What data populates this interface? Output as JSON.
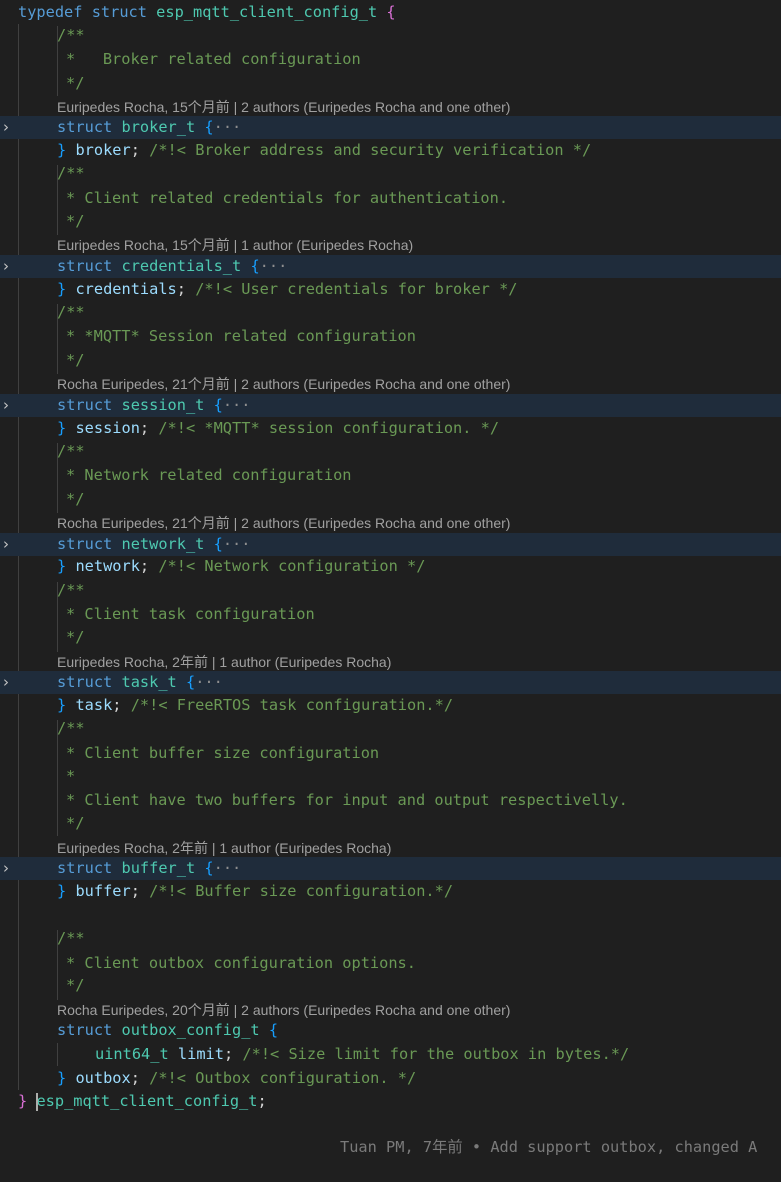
{
  "editor": {
    "lines": {
      "typedef_kw": "typedef",
      "struct_kw": "struct",
      "struct_name": "esp_mqtt_client_config_t",
      "open_brace": "{",
      "c1_open": "/**",
      "c1_body": "*   Broker related configuration",
      "c1_close": "*/",
      "s1_kw": "struct",
      "s1_name": "broker_t",
      "s1_brace": "{",
      "s1_ellipsis": "···",
      "s1_close": "}",
      "s1_member": "broker",
      "s1_semi": ";",
      "s1_comment": "/*!< Broker address and security verification */",
      "c2_open": "/**",
      "c2_body": "* Client related credentials for authentication.",
      "c2_close": "*/",
      "s2_kw": "struct",
      "s2_name": "credentials_t",
      "s2_brace": "{",
      "s2_ellipsis": "···",
      "s2_close": "}",
      "s2_member": "credentials",
      "s2_semi": ";",
      "s2_comment": "/*!< User credentials for broker */",
      "c3_open": "/**",
      "c3_body": "* *MQTT* Session related configuration",
      "c3_close": "*/",
      "s3_kw": "struct",
      "s3_name": "session_t",
      "s3_brace": "{",
      "s3_ellipsis": "···",
      "s3_close": "}",
      "s3_member": "session",
      "s3_semi": ";",
      "s3_comment": "/*!< *MQTT* session configuration. */",
      "c4_open": "/**",
      "c4_body": "* Network related configuration",
      "c4_close": "*/",
      "s4_kw": "struct",
      "s4_name": "network_t",
      "s4_brace": "{",
      "s4_ellipsis": "···",
      "s4_close": "}",
      "s4_member": "network",
      "s4_semi": ";",
      "s4_comment": "/*!< Network configuration */",
      "c5_open": "/**",
      "c5_body": "* Client task configuration",
      "c5_close": "*/",
      "s5_kw": "struct",
      "s5_name": "task_t",
      "s5_brace": "{",
      "s5_ellipsis": "···",
      "s5_close": "}",
      "s5_member": "task",
      "s5_semi": ";",
      "s5_comment": "/*!< FreeRTOS task configuration.*/",
      "c6_open": "/**",
      "c6_body1": "* Client buffer size configuration",
      "c6_body2": "*",
      "c6_body3": "* Client have two buffers for input and output respectivelly.",
      "c6_close": "*/",
      "s6_kw": "struct",
      "s6_name": "buffer_t",
      "s6_brace": "{",
      "s6_ellipsis": "···",
      "s6_close": "}",
      "s6_member": "buffer",
      "s6_semi": ";",
      "s6_comment": "/*!< Buffer size configuration.*/",
      "c7_open": "/**",
      "c7_body": "* Client outbox configuration options.",
      "c7_close": "*/",
      "s7_kw": "struct",
      "s7_name": "outbox_config_t",
      "s7_brace": "{",
      "f7_type": "uint64_t",
      "f7_name": "limit",
      "f7_semi": ";",
      "f7_comment": "/*!< Size limit for the outbox in bytes.*/",
      "s7_close": "}",
      "s7_member": "outbox",
      "s7_semi": ";",
      "s7_comment": "/*!< Outbox configuration. */",
      "end_brace": "}",
      "end_name": "esp_mqtt_client_config_t",
      "end_semi": ";"
    },
    "codelens": {
      "broker": "Euripedes Rocha, 15个月前 | 2 authors (Euripedes Rocha and one other)",
      "credentials": "Euripedes Rocha, 15个月前 | 1 author (Euripedes Rocha)",
      "session": "Rocha Euripedes, 21个月前 | 2 authors (Euripedes Rocha and one other)",
      "network": "Rocha Euripedes, 21个月前 | 2 authors (Euripedes Rocha and one other)",
      "task": "Euripedes Rocha, 2年前 | 1 author (Euripedes Rocha)",
      "buffer": "Euripedes Rocha, 2年前 | 1 author (Euripedes Rocha)",
      "outbox": "Rocha Euripedes, 20个月前 | 2 authors (Euripedes Rocha and one other)"
    },
    "inline_blame": "Tuan PM, 7年前 • Add support outbox, changed A"
  },
  "icons": {
    "fold": "chevron-right-icon"
  },
  "colors": {
    "background": "#1f1f1f",
    "keyword": "#569cd6",
    "type": "#4ec9b0",
    "identifier": "#9cdcfe",
    "comment": "#6a9955",
    "folded_line": "#1f2c3b",
    "codelens": "#a0a0a0"
  }
}
